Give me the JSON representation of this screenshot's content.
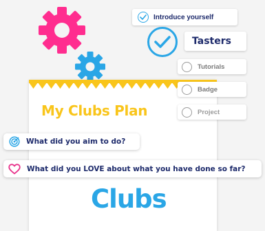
{
  "checklist": {
    "items": [
      {
        "label": "Introduce yourself",
        "state": "done"
      },
      {
        "label": "Tasters",
        "state": "current"
      },
      {
        "label": "Tutorials",
        "state": "pending"
      },
      {
        "label": "Badge",
        "state": "pending"
      },
      {
        "label": "Project",
        "state": "pending"
      }
    ]
  },
  "card": {
    "title": "My Clubs Plan"
  },
  "questions": [
    {
      "label": "What did you aim to do?",
      "icon": "target-icon"
    },
    {
      "label": "What did you LOVE about what you have done so far?",
      "icon": "heart-icon"
    }
  ],
  "logo": {
    "text": "Clubs",
    "color": "#2aa6e6"
  },
  "colors": {
    "accent_blue": "#2aa6e6",
    "gear_pink": "#ff2d8f",
    "gear_blue": "#2aa6e6",
    "title_yellow": "#f9c51b",
    "navy_text": "#1d2a6b",
    "pending_gray": "#9a9a9a",
    "heart_pink": "#e8308a"
  }
}
